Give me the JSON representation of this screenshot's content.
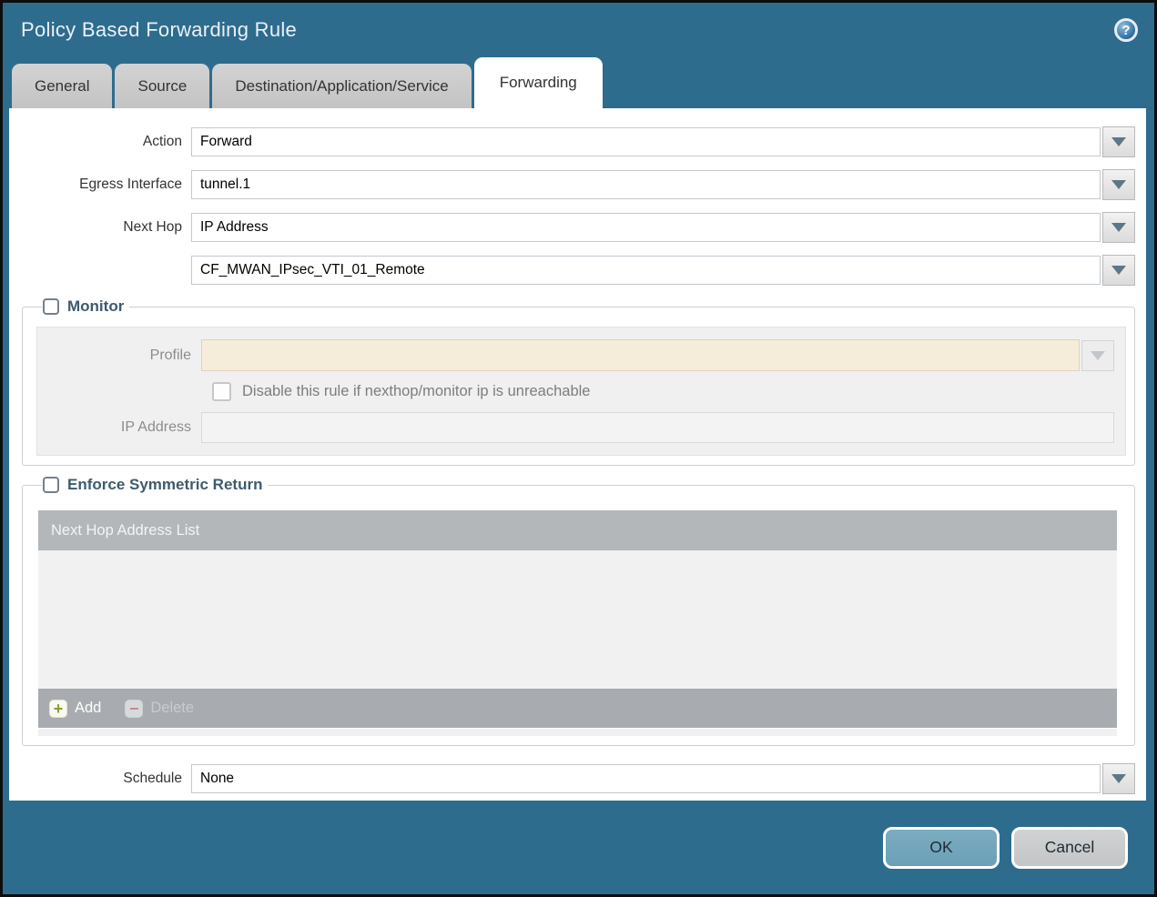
{
  "window": {
    "title": "Policy Based Forwarding Rule",
    "help_icon_glyph": "?"
  },
  "tabs": [
    {
      "label": "General",
      "active": false
    },
    {
      "label": "Source",
      "active": false
    },
    {
      "label": "Destination/Application/Service",
      "active": false
    },
    {
      "label": "Forwarding",
      "active": true
    }
  ],
  "form": {
    "action": {
      "label": "Action",
      "value": "Forward"
    },
    "egress_interface": {
      "label": "Egress Interface",
      "value": "tunnel.1"
    },
    "next_hop": {
      "label": "Next Hop",
      "value": "IP Address"
    },
    "next_hop_address": {
      "value": "CF_MWAN_IPsec_VTI_01_Remote"
    },
    "schedule": {
      "label": "Schedule",
      "value": "None"
    }
  },
  "monitor": {
    "legend": "Monitor",
    "checked": false,
    "profile": {
      "label": "Profile",
      "value": ""
    },
    "disable_rule": {
      "label": "Disable this rule if nexthop/monitor ip is unreachable",
      "checked": false
    },
    "ip_address": {
      "label": "IP Address",
      "value": ""
    }
  },
  "enforce_symmetric_return": {
    "legend": "Enforce Symmetric Return",
    "checked": false,
    "table": {
      "header": "Next Hop Address List",
      "rows": [],
      "add_label": "Add",
      "add_icon_glyph": "+",
      "delete_label": "Delete",
      "delete_icon_glyph": "−",
      "delete_enabled": false
    }
  },
  "footer": {
    "ok_label": "OK",
    "cancel_label": "Cancel"
  },
  "colors": {
    "titlebar_teal": "#2e6c8e",
    "ok_button": "#72a6bb",
    "cancel_button": "#c9cbcd",
    "profile_field_beige": "#f5edda",
    "table_header_gray": "#b3b7ba",
    "legend_text": "#3e5a6d"
  }
}
